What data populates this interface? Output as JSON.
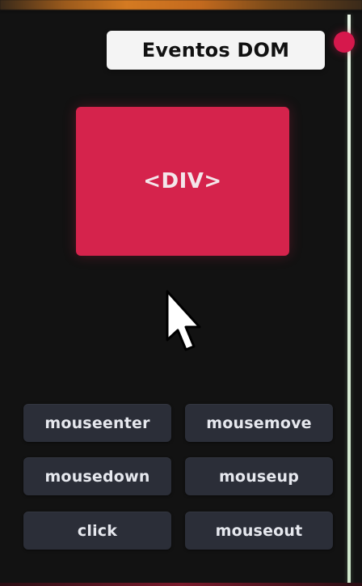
{
  "title": "Eventos DOM",
  "target": {
    "label": "<DIV>"
  },
  "events": [
    {
      "label": "mouseenter"
    },
    {
      "label": "mousemove"
    },
    {
      "label": "mousedown"
    },
    {
      "label": "mouseup"
    },
    {
      "label": "click"
    },
    {
      "label": "mouseout"
    }
  ],
  "colors": {
    "background": "#121212",
    "title_bg": "#f4f4f4",
    "target_bg": "#d5234c",
    "button_bg": "#2b2e38",
    "button_text": "#e6e8ee",
    "rail": "#e9f5e7",
    "knob": "#d6184c"
  },
  "icons": {
    "cursor": "mouse-pointer-icon"
  }
}
